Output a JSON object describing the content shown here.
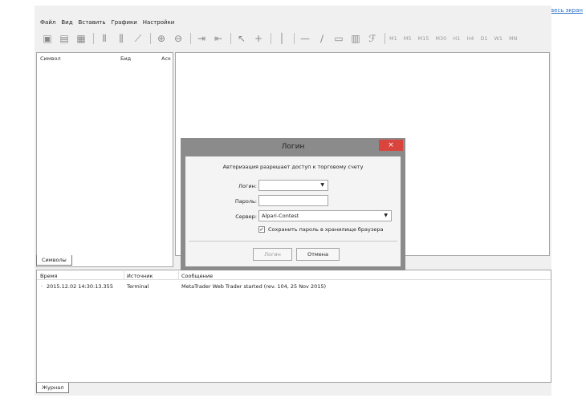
{
  "fullscreen_link": "На весь экран",
  "menu": [
    "Файл",
    "Вид",
    "Вставить",
    "Графики",
    "Настройки"
  ],
  "timeframes": [
    "M1",
    "M5",
    "M15",
    "M30",
    "H1",
    "H4",
    "D1",
    "W1",
    "MN"
  ],
  "symbols": {
    "columns": [
      "Символ",
      "Бид",
      "Аск"
    ],
    "tab_label": "Символы"
  },
  "journal": {
    "columns": [
      "Время",
      "Источник",
      "Сообщение"
    ],
    "rows": [
      {
        "time": "2015.12.02 14:30:13.355",
        "source": "Terminal",
        "message": "MetaTrader Web Trader started (rev. 104, 25 Nov 2015)"
      }
    ],
    "tab_label": "Журнал"
  },
  "login_dialog": {
    "title": "Логин",
    "close": "×",
    "description": "Авторизация разрешает доступ к торговому счету",
    "login_label": "Логин:",
    "login_value": "",
    "password_label": "Пароль:",
    "password_value": "",
    "server_label": "Сервер:",
    "server_value": "Alpari-Contest",
    "save_password_label": "Сохранить пароль в хранилище браузера",
    "save_password_checked": true,
    "login_button": "Логин",
    "cancel_button": "Отмена"
  }
}
